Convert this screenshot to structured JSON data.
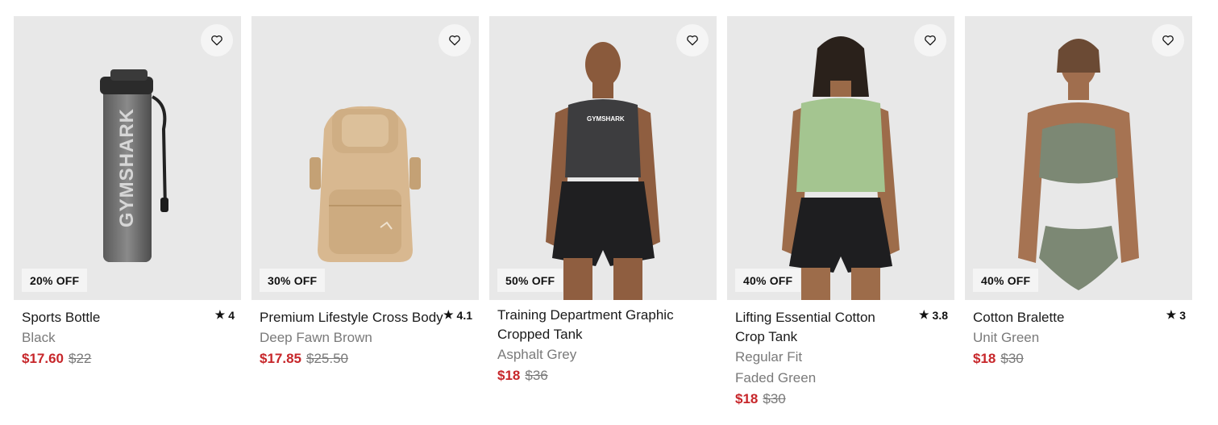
{
  "products": [
    {
      "badge": "20% OFF",
      "title": "Sports Bottle",
      "rating": "4",
      "details": [
        "Black"
      ],
      "sale_price": "$17.60",
      "original_price": "$22",
      "icon": "water-bottle",
      "brand_print": "GYMSHARK"
    },
    {
      "badge": "30% OFF",
      "title": "Premium Lifestyle Cross Body",
      "rating": "4.1",
      "details": [
        "Deep Fawn Brown"
      ],
      "sale_price": "$17.85",
      "original_price": "$25.50",
      "icon": "cross-body-bag"
    },
    {
      "badge": "50% OFF",
      "title": "Training Department Graphic Cropped Tank",
      "rating": "",
      "details": [
        "Asphalt Grey"
      ],
      "sale_price": "$18",
      "original_price": "$36",
      "icon": "model-tank",
      "brand_print": "GYMSHARK"
    },
    {
      "badge": "40% OFF",
      "title": "Lifting Essential Cotton Crop Tank",
      "rating": "3.8",
      "details": [
        "Regular Fit",
        "Faded Green"
      ],
      "sale_price": "$18",
      "original_price": "$30",
      "icon": "model-crop-tank"
    },
    {
      "badge": "40% OFF",
      "title": "Cotton Bralette",
      "rating": "3",
      "details": [
        "Unit Green"
      ],
      "sale_price": "$18",
      "original_price": "$30",
      "icon": "model-bralette"
    }
  ],
  "colors": {
    "sale": "#c7262a",
    "image_bg": "#e8e8e8",
    "muted_text": "#7a7a7a"
  }
}
